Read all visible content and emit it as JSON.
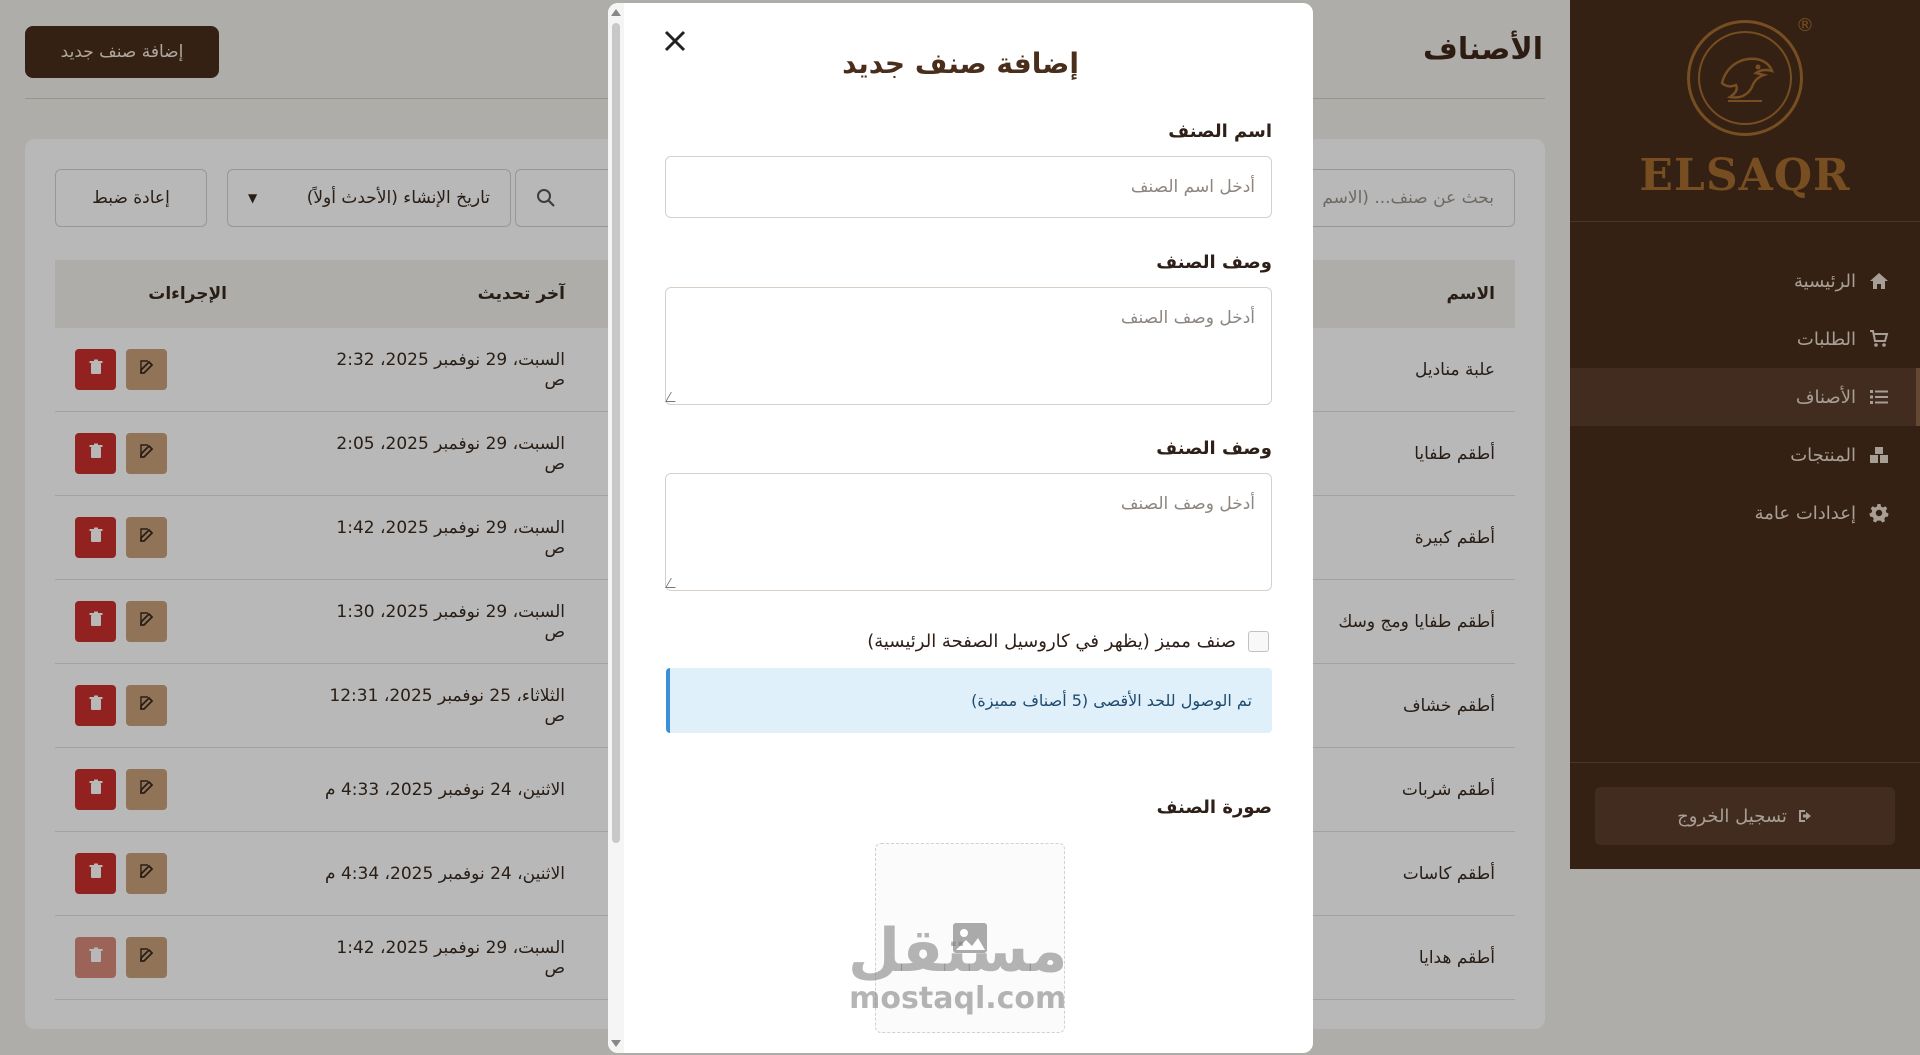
{
  "sidebar": {
    "brand": "ELSAQR",
    "reg_mark": "®",
    "nav": [
      {
        "label": "الرئيسية",
        "icon": "home-icon",
        "active": false
      },
      {
        "label": "الطلبات",
        "icon": "cart-icon",
        "active": false
      },
      {
        "label": "الأصناف",
        "icon": "list-icon",
        "active": true
      },
      {
        "label": "المنتجات",
        "icon": "boxes-icon",
        "active": false
      },
      {
        "label": "إعدادات عامة",
        "icon": "gear-icon",
        "active": false
      }
    ],
    "logout_label": "تسجيل الخروج"
  },
  "header": {
    "title": "الأصناف",
    "add_button": "إضافة صنف جديد"
  },
  "filters": {
    "search_placeholder": "بحث عن صنف... (الاسم",
    "sort_value": "تاريخ الإنشاء (الأحدث أولاً)",
    "reset_label": "إعادة ضبط"
  },
  "table": {
    "headers": {
      "name": "الاسم",
      "updated": "آخر تحديث",
      "actions": "الإجراءات"
    },
    "rows": [
      {
        "name": "علبة مناديل",
        "updated": "السبت، 29 نوفمبر 2025، 2:32 ص",
        "delete_enabled": true
      },
      {
        "name": "أطقم طفايا",
        "updated": "السبت، 29 نوفمبر 2025، 2:05 ص",
        "delete_enabled": true
      },
      {
        "name": "أطقم كبيرة",
        "updated": "السبت، 29 نوفمبر 2025، 1:42 ص",
        "delete_enabled": true
      },
      {
        "name": "أطقم طفايا ومج وسك",
        "updated": "السبت، 29 نوفمبر 2025، 1:30 ص",
        "delete_enabled": true
      },
      {
        "name": "أطقم خشاف",
        "updated": "الثلاثاء، 25 نوفمبر 2025، 12:31 ص",
        "delete_enabled": true
      },
      {
        "name": "أطقم شربات",
        "updated": "الاثنين، 24 نوفمبر 2025، 4:33 م",
        "delete_enabled": true
      },
      {
        "name": "أطقم كاسات",
        "updated": "الاثنين، 24 نوفمبر 2025، 4:34 م",
        "delete_enabled": true
      },
      {
        "name": "أطقم هدايا",
        "updated": "السبت، 29 نوفمبر 2025، 1:42 ص",
        "delete_enabled": false
      }
    ]
  },
  "modal": {
    "title": "إضافة صنف جديد",
    "name_label": "اسم الصنف",
    "name_placeholder": "أدخل اسم الصنف",
    "desc_label": "وصف الصنف",
    "desc_placeholder": "أدخل وصف الصنف",
    "desc2_label": "وصف الصنف",
    "desc2_placeholder": "أدخل وصف الصنف",
    "featured_label": "صنف مميز (يظهر في كاروسيل الصفحة الرئيسية)",
    "featured_checked": false,
    "alert_text": "تم الوصول للحد الأقصى (5 أصناف مميزة)",
    "image_label": "صورة الصنف"
  },
  "watermark": {
    "arabic": "مستقل",
    "latin": "mostaql.com"
  },
  "colors": {
    "brand_brown": "#4a2e1c",
    "accent_gold": "#a46d2e",
    "edit_button": "#c9a07a",
    "delete_button": "#c9302c",
    "alert_bg": "#dff0fb",
    "alert_border": "#3a8fd6"
  }
}
